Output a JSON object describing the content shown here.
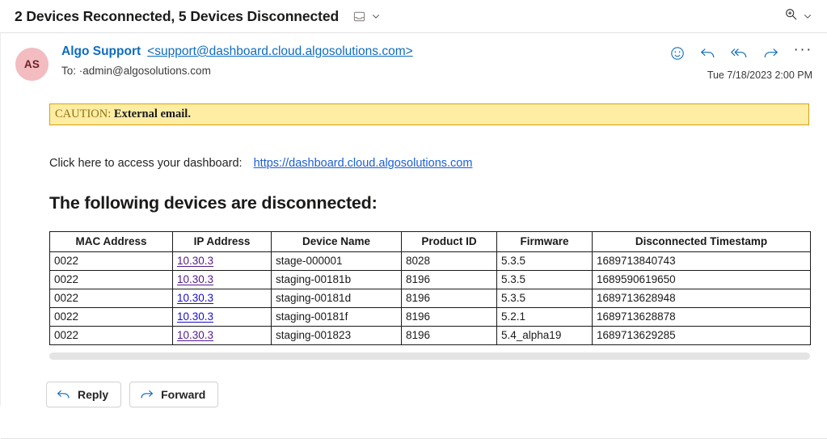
{
  "header": {
    "subject": "2 Devices Reconnected, 5 Devices Disconnected",
    "tray_icon": "inbox-tray-icon",
    "subject_chevron_icon": "chevron-down-icon",
    "zoom_icon": "zoom-in-icon",
    "zoom_chevron_icon": "chevron-down-icon"
  },
  "message": {
    "avatar_initials": "AS",
    "from_name": "Algo Support",
    "from_address": "<support@dashboard.cloud.algosolutions.com>",
    "to_label": "To:",
    "to_address": "·admin@algosolutions.com",
    "timestamp": "Tue 7/18/2023 2:00 PM",
    "actions": [
      {
        "name": "react-smiley-icon",
        "title": "React"
      },
      {
        "name": "reply-icon",
        "title": "Reply"
      },
      {
        "name": "reply-all-icon",
        "title": "Reply all"
      },
      {
        "name": "forward-icon",
        "title": "Forward"
      },
      {
        "name": "more-options-icon",
        "title": "More actions",
        "glyph": "···"
      }
    ]
  },
  "caution": {
    "label": "CAUTION:",
    "text": "External email.",
    "bg_color": "#ffeda3",
    "border_color": "#d4a017"
  },
  "body": {
    "dashboard_prompt": "Click here to access your dashboard:",
    "dashboard_link": "https://dashboard.cloud.algosolutions.com",
    "section_title": "The following devices are disconnected:"
  },
  "table": {
    "columns": [
      "MAC Address",
      "IP Address",
      "Device Name",
      "Product ID",
      "Firmware",
      "Disconnected Timestamp"
    ],
    "rows": [
      {
        "mac": "0022",
        "ip": "10.30.3",
        "ip_state": "visited",
        "device_name": "stage-000001",
        "product_id": "8028",
        "firmware": "5.3.5",
        "disconnected_timestamp": "1689713840743"
      },
      {
        "mac": "0022",
        "ip": "10.30.3",
        "ip_state": "visited",
        "device_name": "staging-00181b",
        "product_id": "8196",
        "firmware": "5.3.5",
        "disconnected_timestamp": "1689590619650"
      },
      {
        "mac": "0022",
        "ip": "10.30.3",
        "ip_state": "unvisited",
        "device_name": "staging-00181d",
        "product_id": "8196",
        "firmware": "5.3.5",
        "disconnected_timestamp": "1689713628948"
      },
      {
        "mac": "0022",
        "ip": "10.30.3",
        "ip_state": "unvisited",
        "device_name": "staging-00181f",
        "product_id": "8196",
        "firmware": "5.2.1",
        "disconnected_timestamp": "1689713628878"
      },
      {
        "mac": "0022",
        "ip": "10.30.3",
        "ip_state": "visited",
        "device_name": "staging-001823",
        "product_id": "8196",
        "firmware": "5.4_alpha19",
        "disconnected_timestamp": "1689713629285"
      }
    ]
  },
  "footer": {
    "reply_label": "Reply",
    "forward_label": "Forward"
  },
  "colors": {
    "link_blue": "#0f6cbd",
    "visited_purple": "#551a8b",
    "unvisited_blue": "#1a0dcc",
    "avatar_bg": "#f2bcc0",
    "avatar_fg": "#6b2229"
  }
}
